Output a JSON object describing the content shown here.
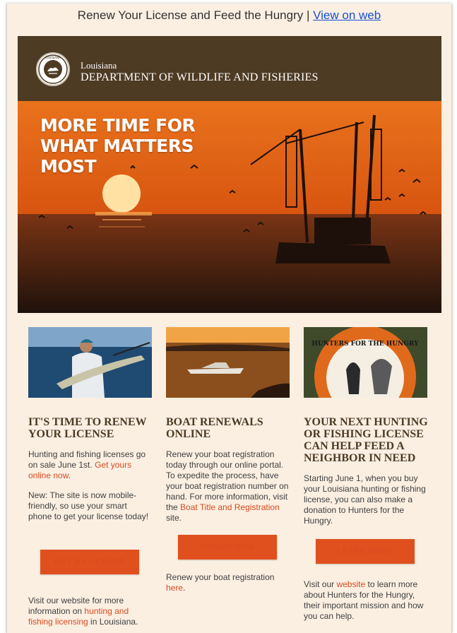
{
  "preheader": {
    "text": "Renew Your License and Feed the Hungry | ",
    "link": "View on web"
  },
  "header": {
    "state": "Louisiana",
    "department": "DEPARTMENT OF WILDLIFE AND FISHERIES",
    "seal_text": "LOUISIANA · WILDLIFE & FISHERIES"
  },
  "hero": {
    "line1": "MORE TIME FOR",
    "line2": "WHAT MATTERS",
    "line3": "MOST"
  },
  "columns": [
    {
      "title": "IT'S TIME TO RENEW YOUR LICENSE",
      "p1_pre": "Hunting and fishing licenses go on sale June 1st. ",
      "p1_link": "Get yours online now",
      "p1_post": ".",
      "p2": "New: The site is now mobile-friendly, so use your smart phone to get your license today!",
      "button": "BUY MY LICENSE",
      "p3_pre": "Visit our website for more information on ",
      "p3_link": "hunting and fishing licensing",
      "p3_post": " in Louisiana."
    },
    {
      "title": "BOAT RENEWALS ONLINE",
      "p1_pre": "Renew your boat registration today through our online portal. To expedite the process, have your boat registration number on hand. For more information, visit the ",
      "p1_link": "Boat Title and Registration",
      "p1_post": " site.",
      "button": "RENEW NOW",
      "p2_pre": "Renew your boat registration ",
      "p2_link": "here",
      "p2_post": "."
    },
    {
      "title": "YOUR NEXT HUNTING OR FISHING LICENSE CAN HELP FEED A NEIGHBOR IN NEED",
      "p1": "Starting June 1, when you buy your Louisiana hunting or fishing license, you can also make a donation to Hunters for the Hungry.",
      "button": "LEARN MORE",
      "p2_pre": "Visit our ",
      "p2_link": "website",
      "p2_post": " to learn more about Hunters for the Hungry, their important mission and how you can help.",
      "logo_text": "HUNTERS FOR THE HUNGRY"
    }
  ],
  "colors": {
    "brown": "#4d3b23",
    "accent": "#e0501e",
    "background": "#fbefe2",
    "link": "#1a4fd6"
  }
}
